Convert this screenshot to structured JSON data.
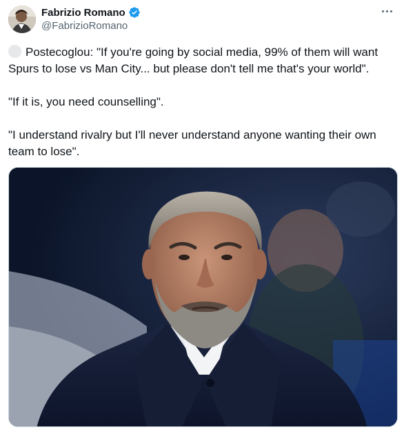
{
  "author": {
    "name": "Fabrizio Romano",
    "handle": "@FabrizioRomano",
    "verified": true
  },
  "tweet": {
    "paragraphs": [
      "Postecoglou: \"If you're going by social media, 99% of them will want Spurs to lose vs Man City... but please don't tell me that's your world\".",
      "\"If it is, you need counselling\".",
      "\"I understand rivalry but I'll never understand anyone wanting their own team to lose\"."
    ]
  },
  "icons": {
    "verified": "verified-badge-icon",
    "more": "more-options-icon"
  },
  "colors": {
    "verified_blue": "#1d9bf0",
    "text": "#0f1419",
    "secondary_text": "#536471"
  }
}
